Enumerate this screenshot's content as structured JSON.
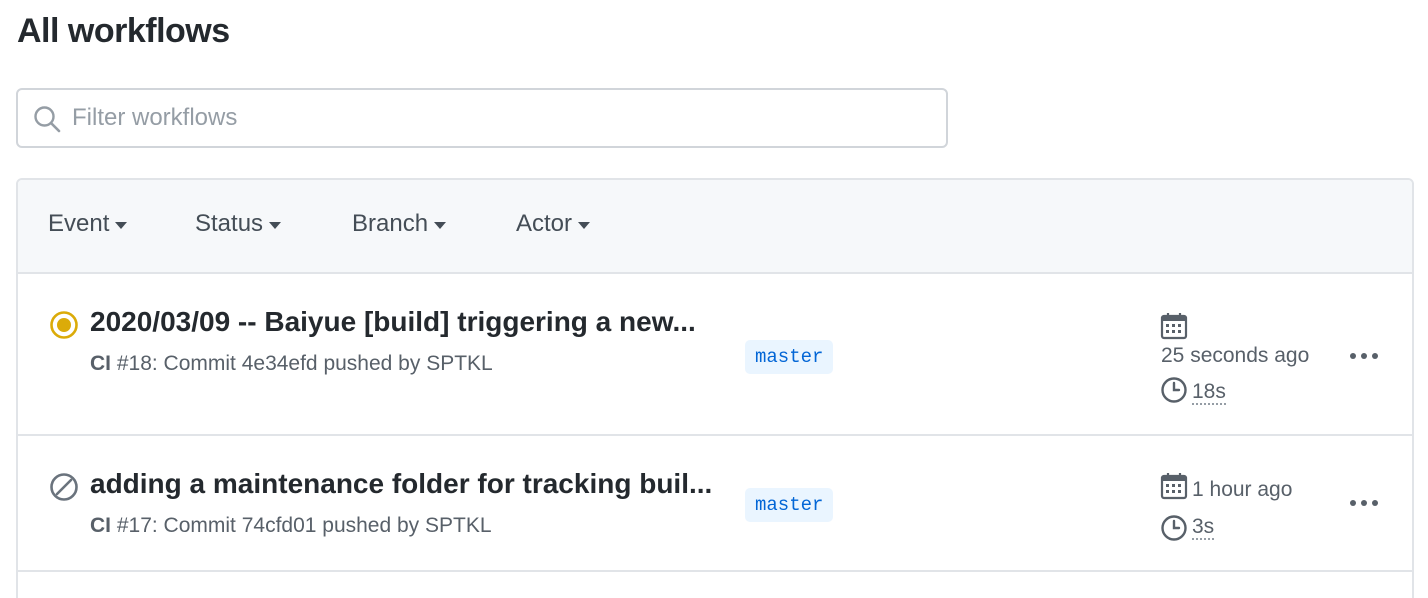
{
  "page": {
    "title": "All workflows"
  },
  "search": {
    "placeholder": "Filter workflows",
    "icon": "search-icon"
  },
  "filters": [
    {
      "label": "Event"
    },
    {
      "label": "Status"
    },
    {
      "label": "Branch"
    },
    {
      "label": "Actor"
    }
  ],
  "runs": [
    {
      "status": "in-progress",
      "status_color": "#dbab09",
      "title": "2020/03/09 -- Baiyue [build] triggering a new...",
      "workflow": "CI",
      "meta": " #18: Commit 4e34efd pushed by SPTKL",
      "branch": "master",
      "time": "25 seconds ago",
      "duration": "18s"
    },
    {
      "status": "cancelled",
      "status_color": "#6a737d",
      "title": "adding a maintenance folder for tracking buil...",
      "workflow": "CI",
      "meta": " #17: Commit 74cfd01 pushed by SPTKL",
      "branch": "master",
      "time": "1 hour ago",
      "duration": "3s"
    }
  ],
  "colors": {
    "accent": "#0366d6",
    "branch_bg": "#eaf5ff",
    "header_bg": "#f6f8fa",
    "border": "#e1e4e8"
  }
}
